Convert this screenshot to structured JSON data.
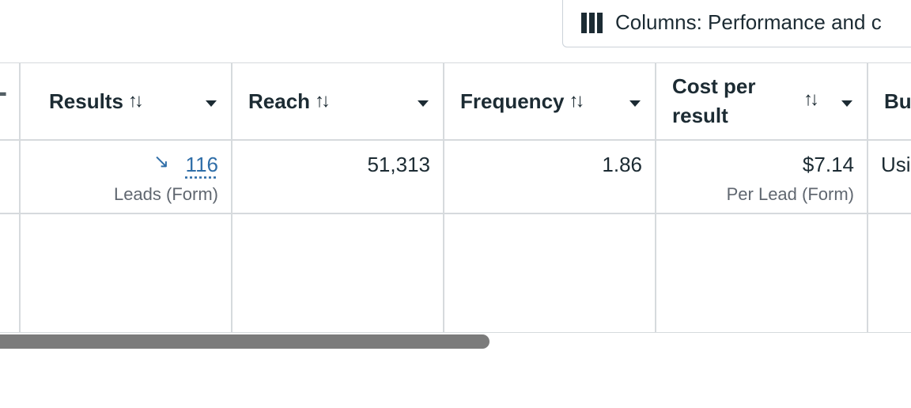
{
  "toolbar": {
    "columns_label": "Columns: Performance and c",
    "columns_icon": "columns-icon"
  },
  "table": {
    "headers": {
      "results": "Results",
      "reach": "Reach",
      "frequency": "Frequency",
      "cost_per_result_line1": "Cost per",
      "cost_per_result_line2": "result",
      "partial_next": "Bu"
    },
    "sort_glyph": "↑↓",
    "row": {
      "results_value": "116",
      "results_sub": "Leads (Form)",
      "reach_value": "51,313",
      "frequency_value": "1.86",
      "cost_value": "$7.14",
      "cost_sub": "Per Lead (Form)",
      "partial_next_value": "Usi"
    }
  },
  "colors": {
    "text": "#1c2b33",
    "link": "#2f6ea8",
    "border": "#d6dadd",
    "scrollbar": "#7b7b7b"
  }
}
